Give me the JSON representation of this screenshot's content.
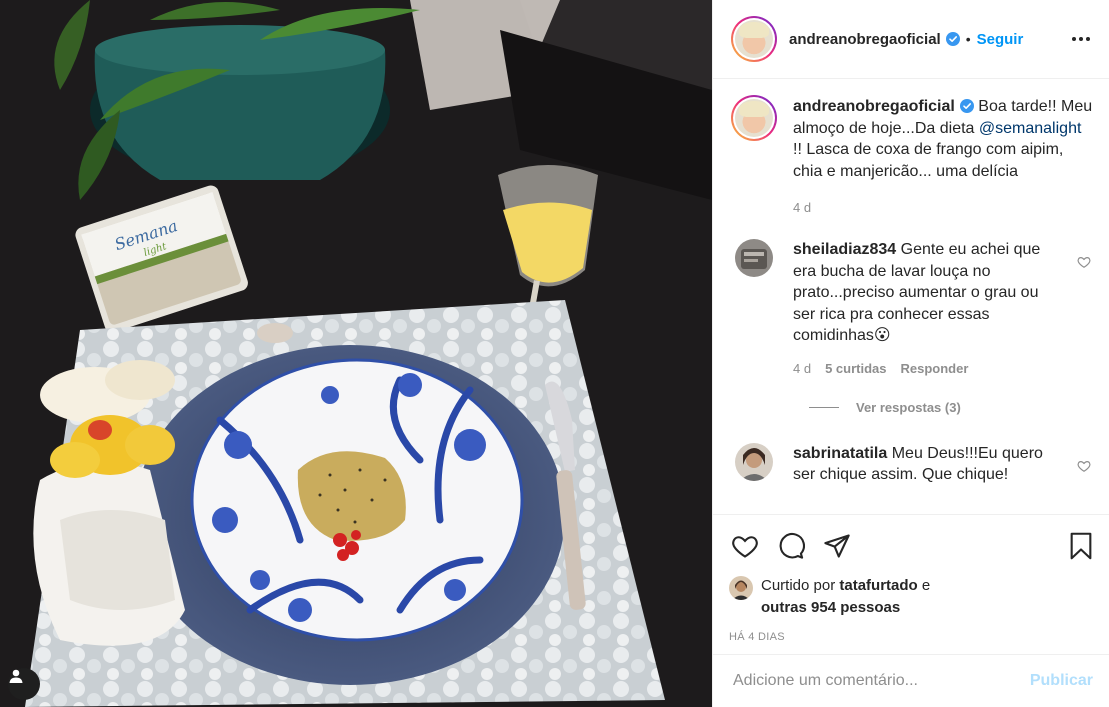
{
  "post": {
    "username": "andreanobregaoficial",
    "follow_label": "Seguir",
    "dot": "•"
  },
  "caption": {
    "username": "andreanobregaoficial",
    "text_before": "Boa tarde!! Meu almoço de hoje...Da dieta ",
    "mention": "@semanalight",
    "text_after": " !! Lasca de coxa de frango com aipim, chia e manjericão... uma delícia",
    "time": "4 d"
  },
  "comments": [
    {
      "username": "sheiladiaz834",
      "text": "Gente eu achei que era bucha de lavar louça no prato...preciso aumentar o grau ou ser rica pra conhecer essas comidinhas😮",
      "time": "4 d",
      "likes": "5 curtidas",
      "reply_label": "Responder",
      "view_replies": "Ver respostas (3)"
    },
    {
      "username": "sabrinatatila",
      "text": "Meu Deus!!!Eu quero ser chique assim. Que chique!"
    }
  ],
  "likes": {
    "prefix": "Curtido por ",
    "user": "tatafurtado",
    "mid": " e",
    "others": "outras 954 pessoas"
  },
  "time_ago": "HÁ 4 DIAS",
  "add_comment": {
    "placeholder": "Adicione um comentário...",
    "post_label": "Publicar"
  },
  "colors": {
    "accent": "#0095f6",
    "post_disabled": "#b2dffc",
    "muted": "#8e8e8e"
  },
  "icons": [
    "verified-icon",
    "more-options-icon",
    "heart-icon",
    "comment-icon",
    "share-icon",
    "bookmark-icon",
    "user-tag-icon"
  ]
}
